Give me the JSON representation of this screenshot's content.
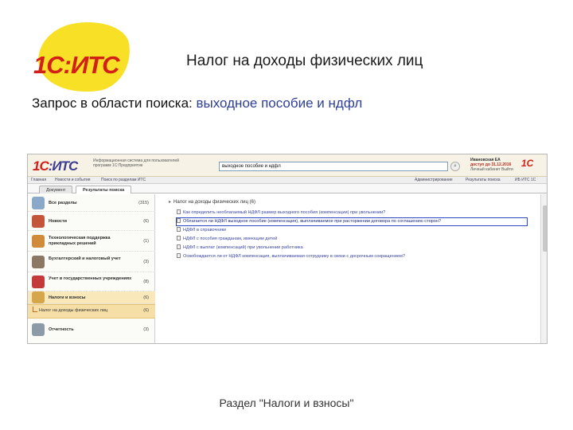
{
  "slide": {
    "logo_text": "1С:ИТС",
    "title": "Налог на доходы физических лиц",
    "query_prefix": "Запрос в области поиска: ",
    "query": "выходное пособие и ндфл",
    "footer": "Раздел \"Налоги и взносы\""
  },
  "app": {
    "logo": {
      "one_c": "1С",
      "its": ":ИТС"
    },
    "description": "Информационная система для пользователей программ 1С:Предприятие",
    "search": {
      "value": "выходное пособие и ндфл",
      "icon": "search-icon"
    },
    "user": {
      "name": "Ивановская ЕА",
      "access": "доступ до 31.12.2016",
      "links": "Личный кабинет Выйти"
    },
    "corner_logo": "1С",
    "toolbar": {
      "menu": [
        "Главная",
        "Новости и события",
        "Поиск по разделам ИТС"
      ],
      "right": [
        "Администрирование",
        "Результаты поиска",
        "ИБ ИТС 1С"
      ]
    },
    "tabs": [
      {
        "label": "Документ",
        "active": false
      },
      {
        "label": "Результаты поиска",
        "active": true
      }
    ],
    "categories": [
      {
        "label": "Все разделы",
        "count": "(315)",
        "color": "#8aa9c9"
      },
      {
        "label": "Новости",
        "count": "(6)",
        "color": "#c4553a"
      },
      {
        "label": "Технологическая поддержка прикладных решений",
        "count": "(1)",
        "color": "#cf8a3a"
      },
      {
        "label": "Бухгалтерский и налоговый учет",
        "count": "(3)",
        "color": "#8b7763"
      },
      {
        "label": "Учет в государственных учреждениях",
        "count": "(8)",
        "color": "#c43a3a"
      },
      {
        "label": "Налоги и взносы",
        "count": "(6)",
        "color": "#d6a64a"
      },
      {
        "label": "Отчетность",
        "count": "(3)",
        "color": "#8d9ba8"
      }
    ],
    "subcategory": {
      "label": "Налог на доходы физических лиц",
      "count": "(6)"
    },
    "breadcrumb": "Налог на доходы физических лиц (6)",
    "results": [
      "Как определить необлагаемый НДФЛ размер выходного пособия (компенсации) при увольнении?",
      "Облагается ли НДФЛ выходное пособие (компенсация), выплачиваемое при расторжении договора по соглашению сторон?",
      "НДФЛ в справочнике",
      "НДФЛ с пособия гражданам, имеющим детей",
      "НДФЛ с выплат (компенсаций) при увольнении работника",
      "Освобождается ли от НДФЛ компенсация, выплачиваемая сотруднику в связи с досрочным сокращением?"
    ],
    "highlighted_result": 1
  }
}
